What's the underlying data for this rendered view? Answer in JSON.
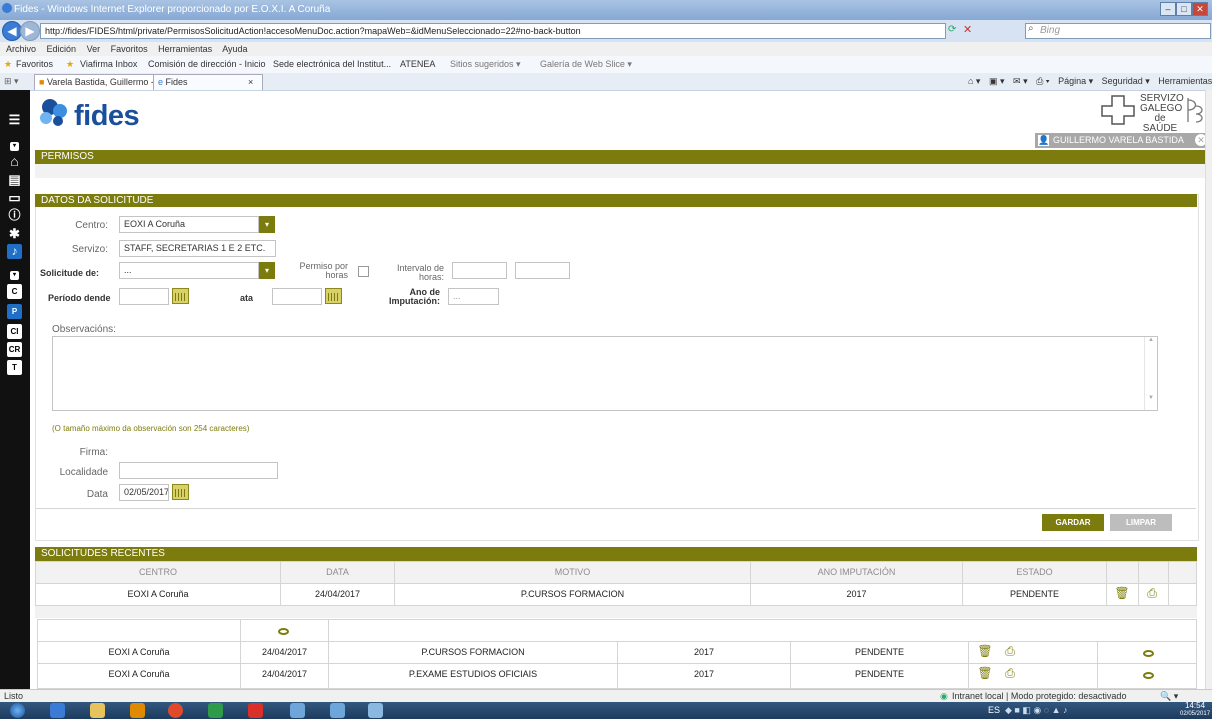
{
  "window": {
    "title": "Fides - Windows Internet Explorer proporcionado por E.O.X.I. A Coruña"
  },
  "browser": {
    "url": "http://fides/FIDES/html/private/PermisosSolicitudAction!accesoMenuDoc.action?mapaWeb=&idMenuSeleccionado=22#no-back-button",
    "search_placeholder": "Bing",
    "menu": [
      "Archivo",
      "Edición",
      "Ver",
      "Favoritos",
      "Herramientas",
      "Ayuda"
    ],
    "favorites_label": "Favoritos",
    "favorites": [
      "Viafirma Inbox",
      "Comisión de dirección - Inicio",
      "Sede electrónica del Institut...",
      "ATENEA",
      "Sitios sugeridos ▾",
      "Galería de Web Slice ▾"
    ],
    "tabs": [
      "Varela Bastida, Guillermo - O...",
      "Fides"
    ],
    "command_items": [
      "Página ▾",
      "Seguridad ▾",
      "Herramientas ▾"
    ],
    "status_text": "Listo",
    "zone_text": "Intranet local | Modo protegido: desactivado",
    "zoom": "",
    "clock_time": "14:54",
    "clock_date": "02/05/2017",
    "lang": "ES"
  },
  "sidebar_tools": [
    "C",
    "P",
    "CI",
    "CR",
    "T"
  ],
  "app": {
    "logo_text": "fides",
    "org": {
      "line1": "SERVIZO",
      "line2": "GALEGO",
      "line3": "de SAÚDE"
    },
    "user_name": "GUILLERMO VARELA BASTIDA",
    "section_title": "PERMISOS",
    "form": {
      "section_title": "DATOS DA SOLICITUDE",
      "centro_label": "Centro:",
      "centro_value": "EOXI A Coruña",
      "servizo_label": "Servizo:",
      "servizo_value": "STAFF, SECRETARIAS 1 E 2 ETC.",
      "solicitude_label": "Solicitude de:",
      "solicitude_value": "...",
      "permiso_horas_label_1": "Permiso por",
      "permiso_horas_label_2": "horas",
      "intervalo_label_1": "Intervalo de",
      "intervalo_label_2": "horas:",
      "periodo_label": "Período dende",
      "ata_label": "ata",
      "ano_imputacion_label_1": "Ano de",
      "ano_imputacion_label_2": "Imputación:",
      "ano_imputacion_value": "...",
      "observacions_label": "Observacións:",
      "max_chars_note": "(O tamaño máximo da observación son 254 caracteres)",
      "firma_label": "Firma:",
      "localidade_label": "Localidade",
      "data_label": "Data",
      "data_value": "02/05/2017",
      "gardar_label": "GARDAR",
      "limpar_label": "LIMPAR"
    },
    "recent": {
      "section_title": "SOLICITUDES RECENTES",
      "columns": [
        "CENTRO",
        "DATA",
        "MOTIVO",
        "ANO IMPUTACIÓN",
        "ESTADO"
      ],
      "rows": [
        {
          "centro": "EOXI A Coruña",
          "data": "24/04/2017",
          "motivo": "P.CURSOS FORMACION",
          "ano": "2017",
          "estado": "PENDENTE"
        }
      ]
    },
    "lower_table": {
      "rows": [
        {
          "centro": "EOXI A Coruña",
          "data": "24/04/2017",
          "motivo": "P.CURSOS FORMACION",
          "ano": "2017",
          "estado": "PENDENTE"
        },
        {
          "centro": "EOXI A Coruña",
          "data": "24/04/2017",
          "motivo": "P.EXAME ESTUDIOS OFICIAIS",
          "ano": "2017",
          "estado": "PENDENTE"
        }
      ]
    }
  },
  "colors": {
    "accent": "#7c7c0e",
    "brand_blue": "#1a4f9c",
    "user_bar": "#a8a8a8"
  }
}
